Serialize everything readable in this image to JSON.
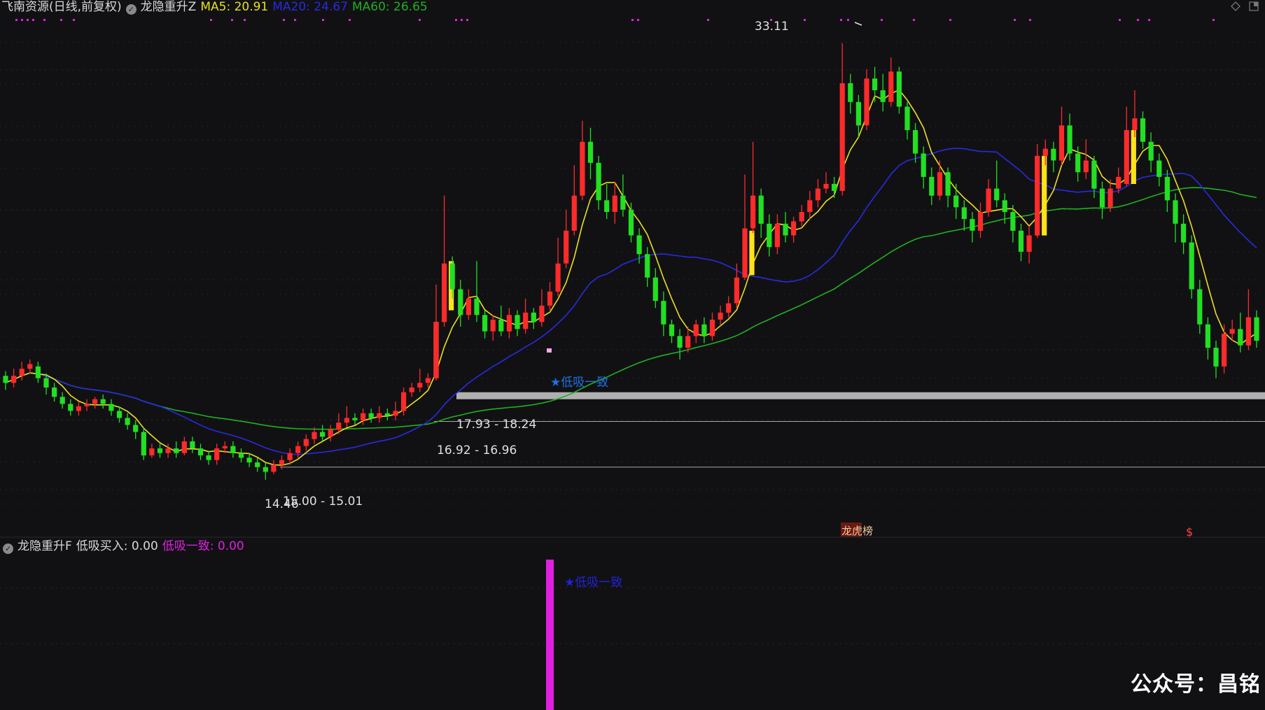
{
  "header": {
    "stock_name": "飞南资源(日线,前复权)",
    "indicator_name": "龙隐重升Z",
    "ma5_label": "MA5: 20.91",
    "ma20_label": "MA20: 24.67",
    "ma60_label": "MA60: 26.65"
  },
  "sub_header": {
    "indicator_name": "龙隐重升F",
    "buy_label": "低吸买入: 0.00",
    "consistent_label": "低吸一致: 0.00"
  },
  "annotations": {
    "high_price": "33.11",
    "low_price": "14.46",
    "band_top": "17.93 - 18.24",
    "band_mid": "16.92 - 16.96",
    "band_low": "15.00 - 15.01",
    "signal_main": "★低吸一致",
    "signal_sub": "★低吸一致",
    "marker_a": "龙虎榜",
    "marker_b": "$"
  },
  "watermark": "公众号：昌铭",
  "colors": {
    "up": "#ff2a2a",
    "down": "#21e021",
    "ma5": "#e8e020",
    "ma20": "#2a2ae0",
    "ma60": "#20b020",
    "signal_bar": "#ffe21a",
    "magenta": "#e020e0",
    "signal_text": "#2070e0"
  },
  "chart_data": {
    "type": "candlestick",
    "price_range": [
      13.2,
      34.3
    ],
    "candles": [
      [
        18.9,
        18.6,
        19.1,
        18.3
      ],
      [
        18.6,
        18.9,
        19.2,
        18.4
      ],
      [
        18.9,
        19.2,
        19.5,
        18.7
      ],
      [
        19.2,
        19.4,
        19.6,
        19.0
      ],
      [
        19.3,
        18.8,
        19.5,
        18.6
      ],
      [
        18.8,
        18.4,
        19.0,
        18.1
      ],
      [
        18.4,
        18.0,
        18.6,
        17.8
      ],
      [
        18.0,
        17.7,
        18.2,
        17.5
      ],
      [
        17.7,
        17.4,
        17.9,
        17.2
      ],
      [
        17.4,
        17.6,
        17.8,
        17.2
      ],
      [
        17.6,
        17.7,
        17.9,
        17.4
      ],
      [
        17.7,
        17.9,
        18.0,
        17.5
      ],
      [
        17.9,
        17.7,
        18.1,
        17.5
      ],
      [
        17.7,
        17.4,
        17.9,
        17.2
      ],
      [
        17.4,
        17.1,
        17.6,
        16.9
      ],
      [
        17.1,
        16.8,
        17.3,
        16.6
      ],
      [
        16.8,
        16.5,
        17.0,
        16.2
      ],
      [
        16.5,
        15.5,
        16.7,
        15.3
      ],
      [
        15.5,
        15.8,
        16.0,
        15.4
      ],
      [
        15.8,
        15.6,
        16.0,
        15.4
      ],
      [
        15.6,
        15.8,
        16.0,
        15.4
      ],
      [
        15.8,
        15.6,
        16.1,
        15.4
      ],
      [
        15.6,
        16.1,
        16.3,
        15.5
      ],
      [
        16.1,
        15.8,
        16.3,
        15.6
      ],
      [
        15.8,
        15.5,
        16.0,
        15.3
      ],
      [
        15.5,
        15.3,
        15.7,
        15.1
      ],
      [
        15.3,
        15.8,
        16.0,
        15.1
      ],
      [
        15.8,
        15.9,
        16.1,
        15.6
      ],
      [
        15.9,
        15.6,
        16.1,
        15.4
      ],
      [
        15.6,
        15.4,
        15.8,
        15.2
      ],
      [
        15.4,
        15.2,
        15.6,
        15.0
      ],
      [
        15.2,
        15.0,
        15.4,
        14.8
      ],
      [
        15.0,
        14.8,
        15.2,
        14.46
      ],
      [
        14.8,
        15.1,
        15.3,
        14.7
      ],
      [
        15.1,
        15.3,
        15.5,
        14.9
      ],
      [
        15.3,
        15.6,
        15.8,
        15.1
      ],
      [
        15.6,
        15.9,
        16.1,
        15.4
      ],
      [
        15.9,
        16.2,
        16.4,
        15.7
      ],
      [
        16.2,
        16.5,
        16.7,
        16.0
      ],
      [
        16.5,
        16.3,
        16.8,
        16.1
      ],
      [
        16.3,
        16.6,
        16.8,
        16.1
      ],
      [
        16.6,
        16.9,
        17.3,
        16.4
      ],
      [
        16.9,
        17.1,
        17.6,
        16.7
      ],
      [
        17.1,
        17.0,
        17.3,
        16.8
      ],
      [
        17.0,
        17.3,
        17.5,
        16.8
      ],
      [
        17.3,
        17.1,
        17.5,
        16.9
      ],
      [
        17.1,
        17.3,
        17.6,
        16.9
      ],
      [
        17.3,
        17.2,
        17.5,
        17.0
      ],
      [
        17.2,
        17.4,
        17.8,
        17.0
      ],
      [
        17.4,
        18.2,
        18.4,
        17.2
      ],
      [
        18.2,
        18.4,
        18.6,
        18.0
      ],
      [
        18.4,
        18.6,
        19.2,
        18.2
      ],
      [
        18.6,
        18.8,
        19.0,
        18.4
      ],
      [
        18.8,
        21.2,
        22.8,
        18.7
      ],
      [
        21.2,
        23.7,
        26.6,
        21.0
      ],
      [
        23.7,
        22.6,
        24.0,
        22.2
      ],
      [
        22.6,
        21.5,
        23.0,
        21.0
      ],
      [
        21.5,
        22.2,
        22.6,
        21.3
      ],
      [
        22.2,
        21.5,
        23.8,
        21.2
      ],
      [
        21.5,
        20.8,
        21.7,
        20.5
      ],
      [
        20.8,
        21.3,
        21.5,
        20.4
      ],
      [
        21.3,
        20.8,
        21.9,
        20.6
      ],
      [
        20.8,
        21.5,
        21.8,
        20.5
      ],
      [
        21.5,
        20.9,
        21.7,
        20.6
      ],
      [
        20.9,
        21.6,
        22.2,
        20.7
      ],
      [
        21.6,
        21.2,
        21.8,
        20.9
      ],
      [
        21.2,
        21.9,
        22.6,
        21.0
      ],
      [
        21.9,
        22.5,
        22.9,
        21.7
      ],
      [
        22.5,
        23.7,
        24.8,
        22.3
      ],
      [
        23.7,
        25.1,
        26.0,
        23.5
      ],
      [
        25.1,
        26.6,
        27.9,
        24.9
      ],
      [
        26.6,
        28.9,
        29.8,
        26.4
      ],
      [
        28.9,
        28.0,
        29.5,
        27.3
      ],
      [
        28.0,
        26.4,
        28.3,
        26.0
      ],
      [
        26.4,
        25.9,
        27.1,
        25.6
      ],
      [
        25.9,
        26.6,
        27.2,
        25.4
      ],
      [
        26.6,
        26.0,
        27.5,
        25.7
      ],
      [
        26.0,
        24.9,
        26.3,
        24.6
      ],
      [
        24.9,
        24.1,
        25.2,
        23.7
      ],
      [
        24.1,
        23.1,
        24.4,
        22.7
      ],
      [
        23.1,
        22.1,
        23.5,
        21.8
      ],
      [
        22.1,
        21.1,
        22.5,
        20.6
      ],
      [
        21.1,
        20.6,
        21.3,
        20.3
      ],
      [
        20.6,
        20.1,
        20.9,
        19.6
      ],
      [
        20.1,
        20.6,
        21.0,
        19.9
      ],
      [
        20.6,
        21.1,
        21.3,
        20.3
      ],
      [
        21.1,
        20.6,
        21.4,
        20.3
      ],
      [
        20.6,
        21.3,
        21.6,
        20.4
      ],
      [
        21.3,
        21.6,
        21.9,
        21.1
      ],
      [
        21.6,
        22.0,
        22.3,
        21.4
      ],
      [
        22.0,
        23.1,
        23.7,
        21.8
      ],
      [
        23.1,
        25.2,
        27.5,
        23.0
      ],
      [
        25.2,
        26.6,
        28.9,
        25.0
      ],
      [
        26.6,
        25.4,
        26.9,
        24.8
      ],
      [
        25.4,
        24.4,
        25.8,
        24.0
      ],
      [
        24.4,
        25.4,
        25.8,
        24.1
      ],
      [
        25.4,
        24.9,
        25.9,
        24.6
      ],
      [
        24.9,
        25.5,
        25.7,
        24.6
      ],
      [
        25.5,
        25.9,
        26.2,
        25.3
      ],
      [
        25.9,
        26.4,
        26.8,
        25.6
      ],
      [
        26.4,
        26.9,
        27.3,
        26.1
      ],
      [
        26.9,
        27.1,
        27.6,
        26.7
      ],
      [
        27.1,
        26.8,
        27.4,
        26.5
      ],
      [
        26.8,
        31.4,
        33.11,
        26.6
      ],
      [
        31.4,
        30.6,
        31.8,
        30.1
      ],
      [
        30.6,
        29.6,
        30.9,
        29.1
      ],
      [
        29.6,
        31.6,
        32.0,
        29.4
      ],
      [
        31.6,
        31.1,
        32.1,
        30.6
      ],
      [
        31.1,
        30.6,
        31.8,
        30.2
      ],
      [
        30.6,
        31.9,
        32.5,
        30.4
      ],
      [
        31.9,
        30.4,
        32.1,
        30.1
      ],
      [
        30.4,
        29.4,
        30.6,
        29.0
      ],
      [
        29.4,
        28.4,
        29.7,
        28.0
      ],
      [
        28.4,
        27.4,
        28.7,
        26.9
      ],
      [
        27.4,
        26.6,
        27.8,
        26.2
      ],
      [
        26.6,
        27.6,
        28.1,
        26.4
      ],
      [
        27.6,
        26.6,
        27.8,
        26.1
      ],
      [
        26.6,
        26.1,
        27.1,
        25.6
      ],
      [
        26.1,
        25.6,
        26.4,
        25.1
      ],
      [
        25.6,
        25.1,
        25.9,
        24.6
      ],
      [
        25.1,
        25.9,
        26.3,
        24.8
      ],
      [
        25.9,
        26.9,
        27.3,
        25.7
      ],
      [
        26.9,
        26.4,
        28.1,
        26.1
      ],
      [
        26.4,
        25.9,
        26.7,
        25.4
      ],
      [
        25.9,
        25.1,
        26.2,
        24.6
      ],
      [
        25.1,
        24.2,
        25.4,
        23.8
      ],
      [
        24.2,
        24.9,
        25.3,
        23.7
      ],
      [
        24.9,
        28.3,
        28.8,
        24.8
      ],
      [
        28.3,
        28.6,
        29.0,
        27.9
      ],
      [
        28.6,
        28.1,
        28.9,
        27.6
      ],
      [
        28.1,
        29.6,
        30.4,
        27.9
      ],
      [
        29.6,
        28.4,
        30.1,
        28.1
      ],
      [
        28.4,
        27.6,
        28.7,
        27.2
      ],
      [
        27.6,
        28.1,
        29.0,
        27.3
      ],
      [
        28.1,
        26.9,
        28.3,
        26.5
      ],
      [
        26.9,
        26.1,
        27.2,
        25.6
      ],
      [
        26.1,
        26.9,
        27.3,
        25.9
      ],
      [
        26.9,
        27.4,
        27.8,
        26.7
      ],
      [
        27.1,
        29.4,
        30.4,
        27.0
      ],
      [
        29.4,
        29.9,
        31.1,
        29.1
      ],
      [
        29.9,
        28.9,
        30.2,
        28.6
      ],
      [
        28.9,
        28.1,
        29.3,
        27.6
      ],
      [
        28.1,
        27.4,
        28.4,
        27.0
      ],
      [
        27.4,
        26.4,
        27.7,
        25.9
      ],
      [
        26.4,
        25.4,
        26.7,
        24.6
      ],
      [
        25.4,
        24.6,
        25.8,
        24.1
      ],
      [
        24.6,
        22.6,
        24.9,
        22.2
      ],
      [
        22.6,
        21.1,
        23.0,
        20.7
      ],
      [
        21.1,
        20.1,
        21.4,
        19.6
      ],
      [
        20.1,
        19.3,
        20.4,
        18.8
      ],
      [
        19.3,
        20.7,
        21.1,
        19.0
      ],
      [
        20.7,
        20.9,
        21.3,
        20.4
      ],
      [
        20.9,
        20.2,
        21.6,
        19.9
      ],
      [
        20.2,
        21.4,
        22.6,
        20.0
      ],
      [
        21.4,
        20.4,
        21.7,
        20.1
      ]
    ],
    "signal_bars": [
      {
        "from": 18.8,
        "to": 21.2
      },
      {
        "from": 21.7,
        "to": 23.8
      },
      {
        "from": 23.2,
        "to": 25.1
      },
      {
        "from": 24.9,
        "to": 28.3
      },
      {
        "from": 27.1,
        "to": 29.4
      }
    ],
    "levels": [
      18.05,
      16.95,
      15.0
    ]
  }
}
